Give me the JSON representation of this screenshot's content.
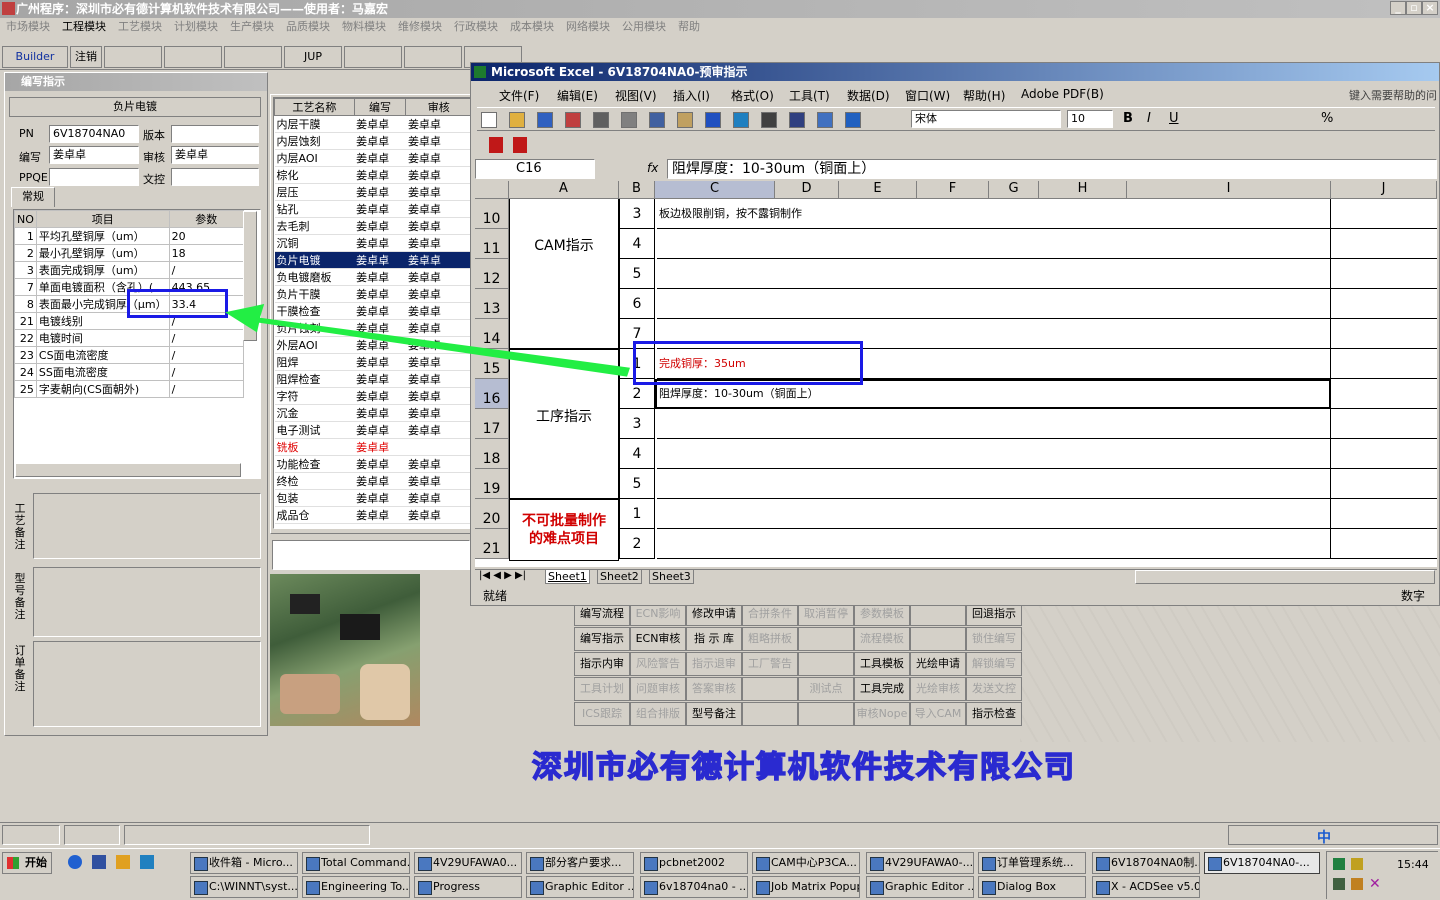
{
  "app": {
    "title": "广州程序：深圳市必有德计算机软件技术有限公司——使用者：马嘉宏",
    "menu": [
      "市场模块",
      "工程模块",
      "工艺模块",
      "计划模块",
      "生产模块",
      "品质模块",
      "物料模块",
      "维修模块",
      "行政模块",
      "成本模块",
      "网络模块",
      "公用模块",
      "帮助"
    ],
    "toolbar": [
      "Builder",
      "注销",
      "",
      "",
      "",
      "JUP",
      "",
      "",
      ""
    ],
    "company_banner": "深圳市必有德计算机软件技术有限公司"
  },
  "panel": {
    "title": "编写指示",
    "section": "负片电镀",
    "pn_label": "PN",
    "pn_value": "6V18704NA0",
    "version_label": "版本",
    "writer_label": "编写",
    "writer_value": "姜卓卓",
    "reviewer_label": "审核",
    "reviewer_value": "姜卓卓",
    "ppqe_label": "PPQE",
    "doc_label": "文控",
    "tab_label": "常规",
    "grid_headers": [
      "NO",
      "项目",
      "参数"
    ],
    "grid_rows": [
      {
        "no": "1",
        "item": "平均孔壁铜厚（um）",
        "param": "20"
      },
      {
        "no": "2",
        "item": "最小孔壁铜厚（um）",
        "param": "18"
      },
      {
        "no": "3",
        "item": "表面完成铜厚（um）",
        "param": "/"
      },
      {
        "no": "7",
        "item": "单面电镀面积（含孔）(",
        "param": "443.65"
      },
      {
        "no": "8",
        "item": "表面最小完成铜厚（μm）",
        "param": "33.4"
      },
      {
        "no": "21",
        "item": "电镀线别",
        "param": "/"
      },
      {
        "no": "22",
        "item": "电镀时间",
        "param": "/"
      },
      {
        "no": "23",
        "item": "CS面电流密度",
        "param": "/"
      },
      {
        "no": "24",
        "item": "SS面电流密度",
        "param": "/"
      },
      {
        "no": "25",
        "item": "字麦朝向(CS面朝外)",
        "param": "/"
      }
    ],
    "notes_labels": [
      "工艺备注",
      "型号备注",
      "订单备注"
    ]
  },
  "process": {
    "headers": [
      "工艺名称",
      "编写",
      "审核"
    ],
    "rows": [
      [
        "内层干膜",
        "姜卓卓",
        "姜卓卓"
      ],
      [
        "内层蚀刻",
        "姜卓卓",
        "姜卓卓"
      ],
      [
        "内层AOI",
        "姜卓卓",
        "姜卓卓"
      ],
      [
        "棕化",
        "姜卓卓",
        "姜卓卓"
      ],
      [
        "层压",
        "姜卓卓",
        "姜卓卓"
      ],
      [
        "钻孔",
        "姜卓卓",
        "姜卓卓"
      ],
      [
        "去毛刺",
        "姜卓卓",
        "姜卓卓"
      ],
      [
        "沉铜",
        "姜卓卓",
        "姜卓卓"
      ],
      [
        "负片电镀",
        "姜卓卓",
        "姜卓卓"
      ],
      [
        "负电镀磨板",
        "姜卓卓",
        "姜卓卓"
      ],
      [
        "负片干膜",
        "姜卓卓",
        "姜卓卓"
      ],
      [
        "干膜检查",
        "姜卓卓",
        "姜卓卓"
      ],
      [
        "负片蚀刻",
        "姜卓卓",
        "姜卓卓"
      ],
      [
        "外层AOI",
        "姜卓卓",
        "姜卓卓"
      ],
      [
        "阻焊",
        "姜卓卓",
        "姜卓卓"
      ],
      [
        "阻焊检查",
        "姜卓卓",
        "姜卓卓"
      ],
      [
        "字符",
        "姜卓卓",
        "姜卓卓"
      ],
      [
        "沉金",
        "姜卓卓",
        "姜卓卓"
      ],
      [
        "电子测试",
        "姜卓卓",
        "姜卓卓"
      ],
      [
        "铣板",
        "姜卓卓",
        ""
      ],
      [
        "功能检查",
        "姜卓卓",
        "姜卓卓"
      ],
      [
        "终检",
        "姜卓卓",
        "姜卓卓"
      ],
      [
        "包装",
        "姜卓卓",
        "姜卓卓"
      ],
      [
        "成品仓",
        "姜卓卓",
        "姜卓卓"
      ]
    ],
    "selected_index": 8,
    "red_index": 19
  },
  "excel": {
    "title": "Microsoft Excel - 6V18704NA0-预审指示",
    "menu": [
      "文件(F)",
      "编辑(E)",
      "视图(V)",
      "插入(I)",
      "格式(O)",
      "工具(T)",
      "数据(D)",
      "窗口(W)",
      "帮助(H)",
      "Adobe PDF(B)"
    ],
    "help_placeholder": "键入需要帮助的问",
    "font_name": "宋体",
    "font_size": "10",
    "cell_ref": "C16",
    "fx": "fx",
    "formula": "阻焊厚度：10-30um（铜面上）",
    "columns": [
      "A",
      "B",
      "C",
      "D",
      "E",
      "F",
      "G",
      "H",
      "I",
      "J"
    ],
    "rows": [
      {
        "num": "10",
        "b": "3",
        "c": "板边极限削铜，按不露铜制作"
      },
      {
        "num": "11",
        "b": "4",
        "c": ""
      },
      {
        "num": "12",
        "b": "5",
        "c": ""
      },
      {
        "num": "13",
        "b": "6",
        "c": ""
      },
      {
        "num": "14",
        "b": "7",
        "c": ""
      },
      {
        "num": "15",
        "b": "1",
        "c": "完成铜厚：35um"
      },
      {
        "num": "16",
        "b": "2",
        "c": "阻焊厚度：10-30um（铜面上）"
      },
      {
        "num": "17",
        "b": "3",
        "c": ""
      },
      {
        "num": "18",
        "b": "4",
        "c": ""
      },
      {
        "num": "19",
        "b": "5",
        "c": ""
      },
      {
        "num": "20",
        "b": "1",
        "c": ""
      },
      {
        "num": "21",
        "b": "2",
        "c": ""
      }
    ],
    "cam_label": "CAM指示",
    "process_label": "工序指示",
    "difficult_label": "不可批量制作的难点项目",
    "sheets": [
      "Sheet1",
      "Sheet2",
      "Sheet3"
    ],
    "status": "就绪",
    "status_right": "数字"
  },
  "func_buttons": [
    [
      "编写流程",
      "ECN影响",
      "修改申请",
      "合拼条件",
      "取消暂停",
      "参数模板",
      "",
      "回退指示"
    ],
    [
      "编写指示",
      "ECN审核",
      "指 示 库",
      "粗略拼板",
      "",
      "流程模板",
      "",
      "锁住编写"
    ],
    [
      "指示内审",
      "风险警告",
      "指示退审",
      "工厂警告",
      "",
      "工具模板",
      "光绘申请",
      "解锁编写"
    ],
    [
      "工具计划",
      "问题审核",
      "答案审核",
      "",
      "测试点",
      "工具完成",
      "光绘审核",
      "发送文控"
    ],
    [
      "ICS跟踪",
      "组合排版",
      "型号备注",
      "",
      "",
      "审核Nope",
      "导入CAM",
      "指示检查"
    ]
  ],
  "func_disabled": [
    [
      false,
      true,
      false,
      true,
      true,
      true,
      false,
      false
    ],
    [
      false,
      false,
      false,
      true,
      false,
      true,
      false,
      true
    ],
    [
      false,
      true,
      true,
      true,
      false,
      false,
      false,
      true
    ],
    [
      true,
      true,
      true,
      false,
      true,
      false,
      true,
      true
    ],
    [
      true,
      true,
      false,
      false,
      false,
      true,
      true,
      false
    ]
  ],
  "taskbar": {
    "start": "开始",
    "row1": [
      "收件箱 - Micro...",
      "Total Command...",
      "4V29UFAWA0...",
      "部分客户要求...",
      "pcbnet2002",
      "CAM中心P3CA...",
      "4V29UFAWA0-...",
      "订单管理系统...",
      "6V18704NA0制...",
      "6V18704NA0-..."
    ],
    "row2": [
      "C:\\WINNT\\syst...",
      "Engineering To...",
      "Progress",
      "Graphic Editor ...",
      "6v18704na0 - ...",
      "Job Matrix Popup",
      "Graphic Editor ...",
      "Dialog Box",
      "X - ACDSee v5.0"
    ],
    "clock": "15:44",
    "ime": "中"
  }
}
